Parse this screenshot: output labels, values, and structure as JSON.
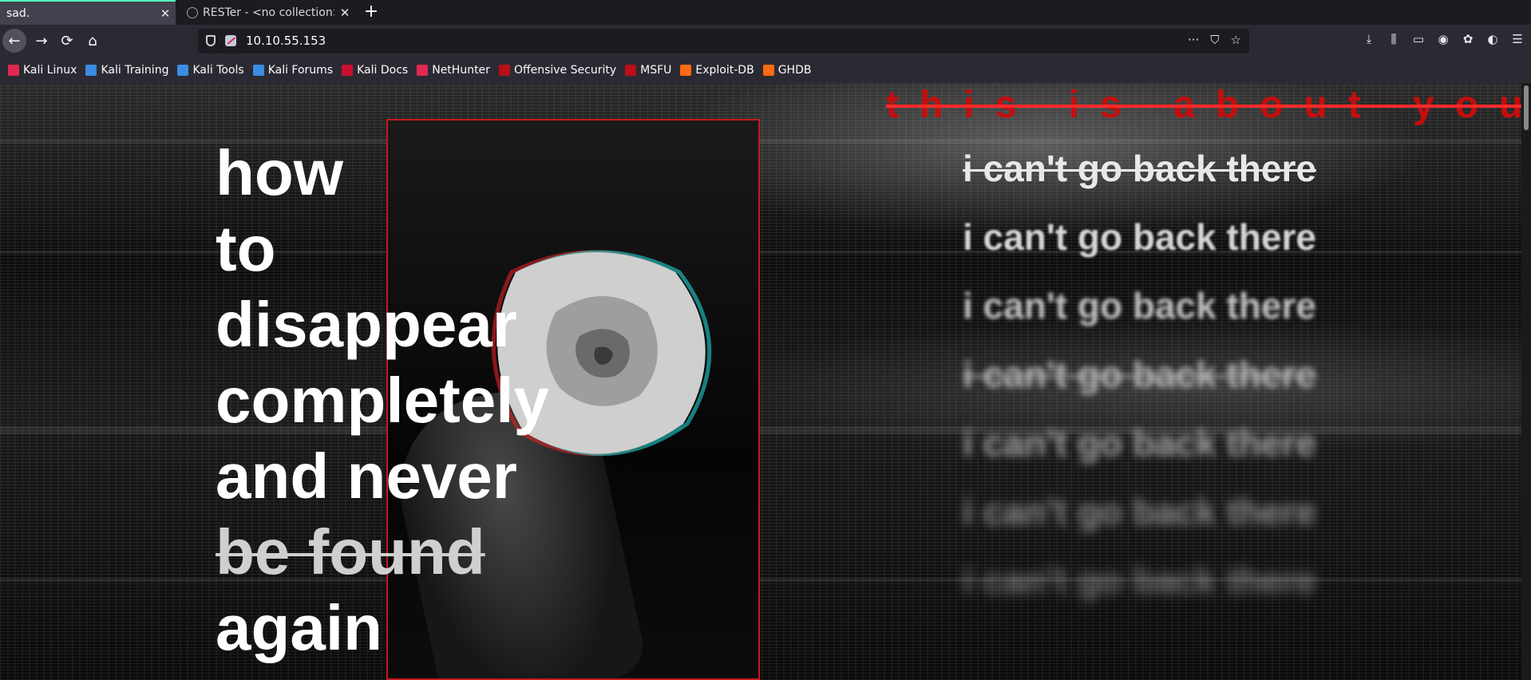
{
  "tabs": [
    {
      "label": "sad.",
      "active": true
    },
    {
      "label": "RESTer - <no collection>",
      "active": false
    }
  ],
  "nav": {
    "back": "←",
    "forward": "→",
    "reload": "⟳",
    "home": "⌂",
    "newtab": "+"
  },
  "urlbar": {
    "url": "10.10.55.153",
    "tools": [
      "···",
      "⛉",
      "☆"
    ]
  },
  "toolbar_icons": [
    "download-icon",
    "library-icon",
    "sidebar-icon",
    "account-icon",
    "extension-icon",
    "extension-icon-2",
    "menu-icon"
  ],
  "bookmarks": [
    {
      "label": "Kali Linux",
      "color": "#e22850"
    },
    {
      "label": "Kali Training",
      "color": "#3a8de0"
    },
    {
      "label": "Kali Tools",
      "color": "#3a8de0"
    },
    {
      "label": "Kali Forums",
      "color": "#3a8de0"
    },
    {
      "label": "Kali Docs",
      "color": "#c8102e"
    },
    {
      "label": "NetHunter",
      "color": "#e22850"
    },
    {
      "label": "Offensive Security",
      "color": "#b80f18"
    },
    {
      "label": "MSFU",
      "color": "#b80f18"
    },
    {
      "label": "Exploit-DB",
      "color": "#ff6a13"
    },
    {
      "label": "GHDB",
      "color": "#ff6a13"
    }
  ],
  "page": {
    "headline": [
      "how",
      "to",
      "disappear",
      "completely",
      "and never",
      "be found",
      "again"
    ],
    "struck_line": "be found",
    "tagline": "this is about you",
    "repeated_line": "i can't go back there",
    "repeat_count": 7,
    "accent": "#c40e0e"
  }
}
